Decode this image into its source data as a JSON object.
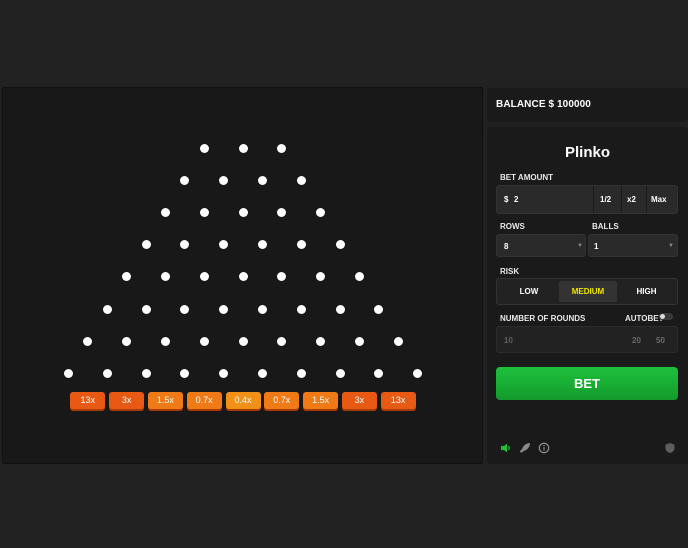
{
  "balance": {
    "label": "BALANCE $ 100000"
  },
  "game": {
    "title": "Plinko",
    "bet_amount": {
      "label": "BET AMOUNT",
      "currency": "$",
      "value": "2",
      "half_label": "1/2",
      "double_label": "x2",
      "max_label": "Max"
    },
    "rows": {
      "label": "ROWS",
      "value": "8"
    },
    "balls": {
      "label": "BALLS",
      "value": "1"
    },
    "risk": {
      "label": "RISK",
      "options": [
        "LOW",
        "MEDIUM",
        "HIGH"
      ],
      "selected": "MEDIUM"
    },
    "rounds": {
      "label": "NUMBER OF ROUNDS",
      "value": "10",
      "preset_20": "20",
      "preset_50": "50"
    },
    "autobet": {
      "label": "AUTOBET",
      "enabled": false
    },
    "bet_button": "BET"
  },
  "board": {
    "peg_rows": [
      3,
      4,
      5,
      6,
      7,
      8,
      9,
      10
    ],
    "multipliers": [
      "13x",
      "3x",
      "1.5x",
      "0.7x",
      "0.4x",
      "0.7x",
      "1.5x",
      "3x",
      "13x"
    ]
  },
  "colors": {
    "accent_green": "#1ec13d",
    "highlight_yellow": "#f2e600",
    "bucket_orange": "#e85a13"
  },
  "footer_icons": [
    "sound-icon",
    "rocket-icon",
    "info-icon",
    "shield-icon"
  ]
}
